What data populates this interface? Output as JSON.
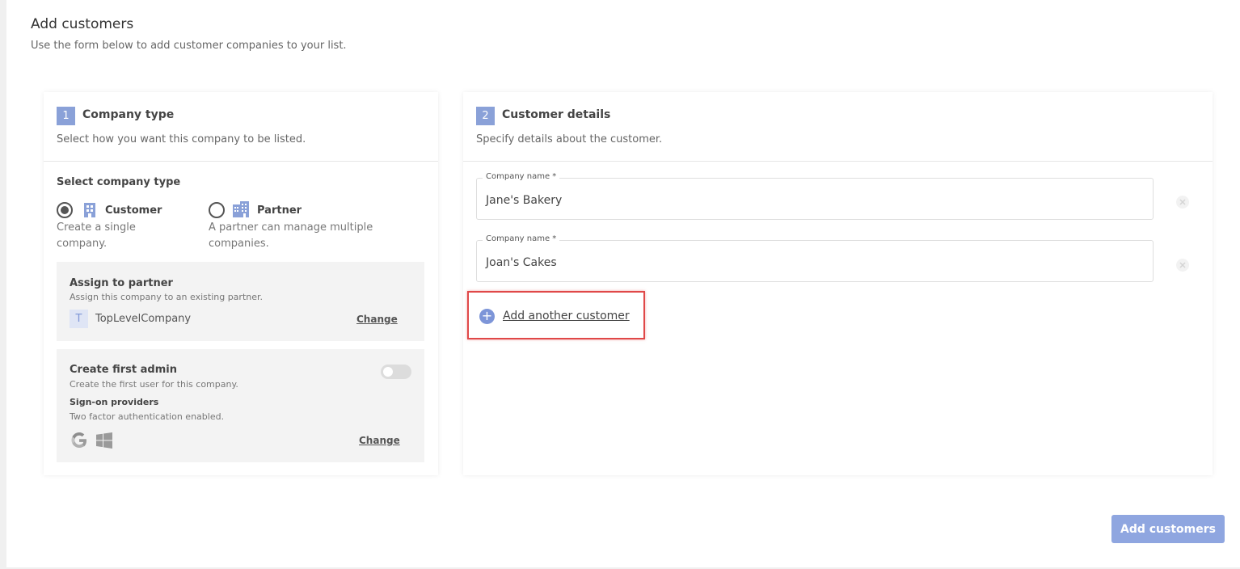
{
  "header": {
    "title": "Add customers",
    "subtitle": "Use the form below to add customer companies to your list."
  },
  "company_type": {
    "step": "1",
    "title": "Company type",
    "description": "Select how you want this company to be listed.",
    "section_label": "Select company type",
    "options": [
      {
        "label": "Customer",
        "description": "Create a single company.",
        "selected": true
      },
      {
        "label": "Partner",
        "description": "A partner can manage multiple companies.",
        "selected": false
      }
    ],
    "assign_partner": {
      "title": "Assign to partner",
      "subtitle": "Assign this company to an existing partner.",
      "avatar_letter": "T",
      "partner_name": "TopLevelCompany",
      "change_label": "Change"
    },
    "first_admin": {
      "title": "Create first admin",
      "subtitle": "Create the first user for this company.",
      "providers_label": "Sign-on providers",
      "providers_subtitle": "Two factor authentication enabled.",
      "toggle_on": false,
      "providers": [
        "google-icon",
        "windows-icon"
      ],
      "change_label": "Change"
    }
  },
  "customer_details": {
    "step": "2",
    "title": "Customer details",
    "description": "Specify details about the customer.",
    "customers": [
      {
        "label": "Company name *",
        "value": "Jane's Bakery"
      },
      {
        "label": "Company name *",
        "value": "Joan's Cakes"
      }
    ],
    "add_another_label": "Add another customer"
  },
  "actions": {
    "submit_label": "Add customers"
  },
  "colors": {
    "accent": "#8aa1d8",
    "button": "#8fa6e0",
    "highlight": "#e04848"
  }
}
